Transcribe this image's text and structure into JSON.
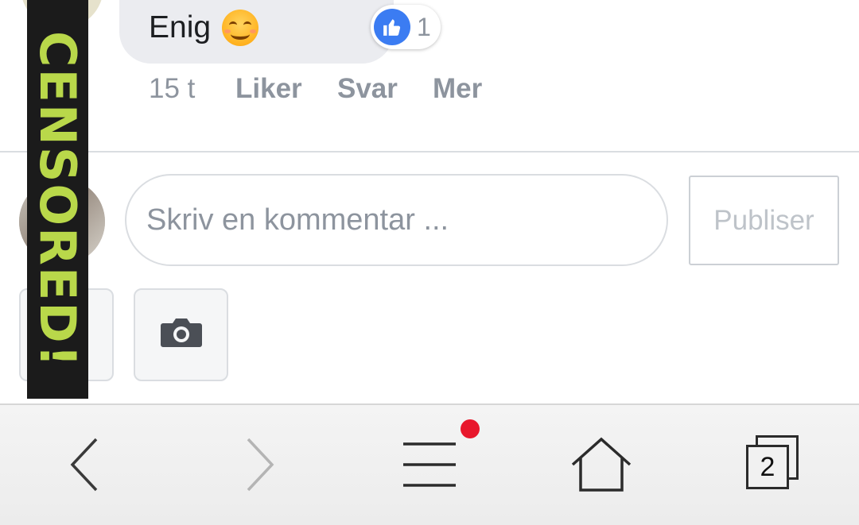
{
  "comment": {
    "text": "Enig",
    "emoji": "smiling-face-emoji",
    "reaction_icon": "thumbs-up-icon",
    "reaction_count": "1",
    "time": "15 t",
    "like_label": "Liker",
    "reply_label": "Svar",
    "more_label": "Mer"
  },
  "composer": {
    "placeholder": "Skriv en kommentar ...",
    "publish_label": "Publiser",
    "tools": [
      "sticker-icon",
      "camera-icon"
    ]
  },
  "overlay": {
    "censor_text": "CENSORED!"
  },
  "browser_bar": {
    "back_icon": "chevron-left-icon",
    "forward_icon": "chevron-right-icon",
    "menu_icon": "hamburger-menu-icon",
    "home_icon": "home-icon",
    "tabs_count": "2"
  },
  "colors": {
    "accent": "#3b7cf2",
    "bubble": "#ebecf0",
    "notification": "#e8172c",
    "censor_bg": "#1b1b1b",
    "censor_text": "#b9d84a"
  }
}
